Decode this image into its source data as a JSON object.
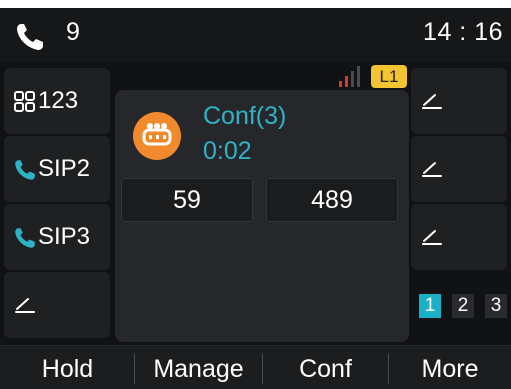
{
  "status_bar": {
    "line_icon": "phone-handset-icon",
    "line_count": "9",
    "time": "14 : 16"
  },
  "left_keys": [
    {
      "label": "123",
      "icon": "grid-icon"
    },
    {
      "label": "SIP2",
      "icon": "phone-handset-icon"
    },
    {
      "label": "SIP3",
      "icon": "phone-handset-icon"
    },
    {
      "label": "",
      "icon": "edit-pen-icon"
    }
  ],
  "right_keys": [
    {
      "icon": "edit-pen-icon"
    },
    {
      "icon": "edit-pen-icon"
    },
    {
      "icon": "edit-pen-icon"
    }
  ],
  "signal": {
    "icon": "signal-bars-icon"
  },
  "account_badge": "L1",
  "call": {
    "avatar_icon": "conference-icon",
    "title": "Conf(3)",
    "duration": "0:02",
    "participants": [
      "59",
      "489"
    ]
  },
  "pages": [
    {
      "label": "1",
      "active": true
    },
    {
      "label": "2",
      "active": false
    },
    {
      "label": "3",
      "active": false
    }
  ],
  "softkeys": [
    "Hold",
    "Manage",
    "Conf",
    "More"
  ],
  "colors": {
    "accent": "#2fb2c7",
    "avatar": "#f08a2c",
    "badge": "#f2c431",
    "page_active": "#1ab0c8",
    "signal": "#e0342f"
  }
}
